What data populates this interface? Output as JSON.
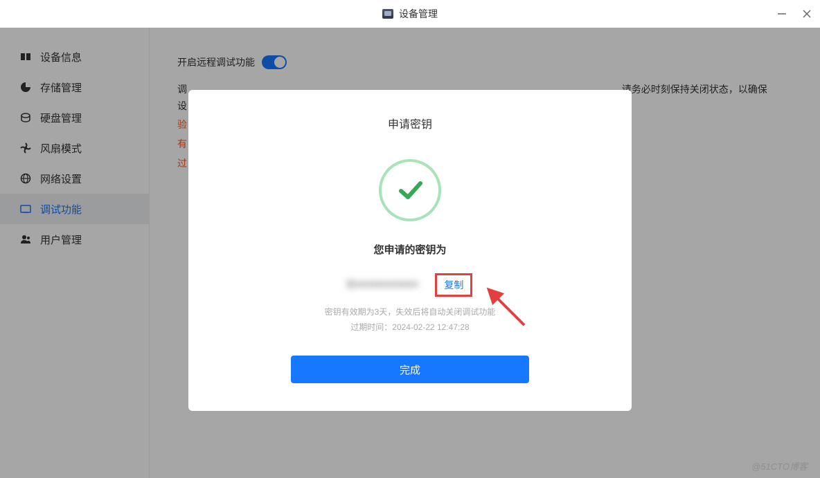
{
  "window": {
    "title": "设备管理"
  },
  "sidebar": {
    "items": [
      {
        "label": "设备信息"
      },
      {
        "label": "存储管理"
      },
      {
        "label": "硬盘管理"
      },
      {
        "label": "风扇模式"
      },
      {
        "label": "网络设置"
      },
      {
        "label": "调试功能"
      },
      {
        "label": "用户管理"
      }
    ]
  },
  "content": {
    "toggle_label": "开启远程调试功能",
    "desc_part1": "调",
    "desc_part2": "请务必时刻保持关闭状态，以确保",
    "desc_line2": "设",
    "orange1": "验",
    "orange2": "有",
    "orange3": "过"
  },
  "modal": {
    "title": "申请密钥",
    "key_label": "您申请的密钥为",
    "key_value": "K•••••••••••••••",
    "copy_label": "复制",
    "expire_line1": "密钥有效期为3天，失效后将自动关闭调试功能",
    "expire_line2": "过期时间：2024-02-22 12:47:28",
    "done_label": "完成"
  },
  "watermark": "@51CTO博客"
}
